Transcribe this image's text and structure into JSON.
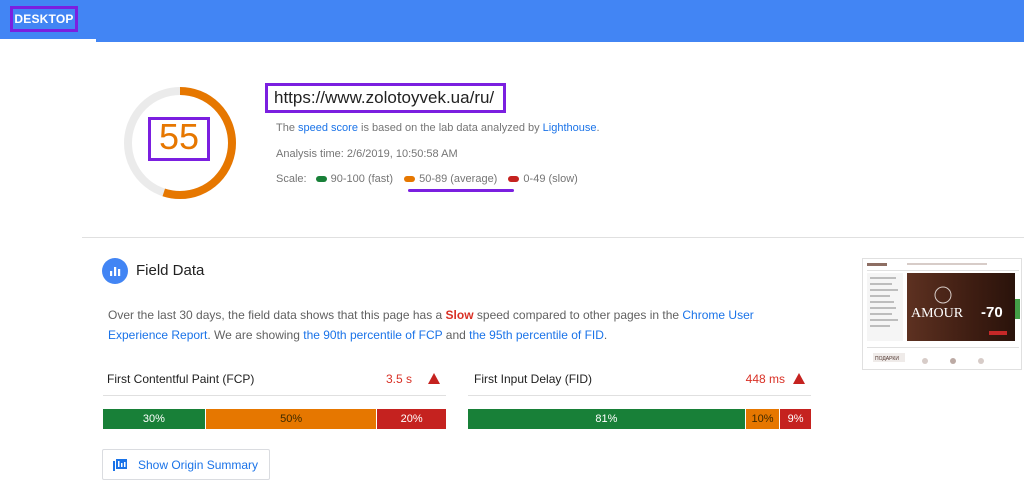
{
  "header": {
    "tab_label": "DESKTOP",
    "bar_color": "#4285f4",
    "highlight_color": "#7b1fe0"
  },
  "summary": {
    "score": "55",
    "score_color": "#e67700",
    "score_fraction": 0.55,
    "url": "https://www.zolotoyvek.ua/ru/",
    "speed_prefix": "The",
    "speed_link": "speed score",
    "speed_mid": "is based on the lab data analyzed by",
    "speed_source": "Lighthouse",
    "speed_end": ".",
    "analysis_time": "Analysis time: 2/6/2019, 10:50:58 AM",
    "scale_label": "Scale:",
    "scale": [
      {
        "label": "90-100 (fast)",
        "color": "#188038"
      },
      {
        "label": "50-89 (average)",
        "color": "#e67700"
      },
      {
        "label": "0-49 (slow)",
        "color": "#c5221f"
      }
    ]
  },
  "field_data": {
    "title": "Field Data",
    "icon": "bar-chart-icon",
    "desc_1": "Over the last 30 days, the field data shows that this page has a",
    "desc_slow": "Slow",
    "desc_2": "speed compared to other pages in the",
    "desc_link_1": "Chrome User Experience Report",
    "desc_3": ". We are showing",
    "desc_link_2": "the 90th percentile of FCP",
    "desc_4": "and",
    "desc_link_3": "the 95th percentile of FID",
    "desc_5": ".",
    "metrics": [
      {
        "label": "First Contentful Paint (FCP)",
        "value": "3.5 s",
        "icon": "warning-icon",
        "distribution": [
          {
            "label": "30%",
            "pct": 30,
            "color": "#188038"
          },
          {
            "label": "50%",
            "pct": 50,
            "color": "#e67700"
          },
          {
            "label": "20%",
            "pct": 20,
            "color": "#c5221f"
          }
        ]
      },
      {
        "label": "First Input Delay (FID)",
        "value": "448 ms",
        "icon": "warning-icon",
        "distribution": [
          {
            "label": "81%",
            "pct": 81,
            "color": "#188038"
          },
          {
            "label": "10%",
            "pct": 10,
            "color": "#e67700"
          },
          {
            "label": "9%",
            "pct": 9,
            "color": "#c5221f"
          }
        ]
      }
    ],
    "origin_button": "Show Origin Summary",
    "origin_icon": "library-icon"
  },
  "thumbnail": {
    "banner_text": "AMOUR",
    "discount": "-70",
    "button_text": "ПОДАРКИ"
  }
}
